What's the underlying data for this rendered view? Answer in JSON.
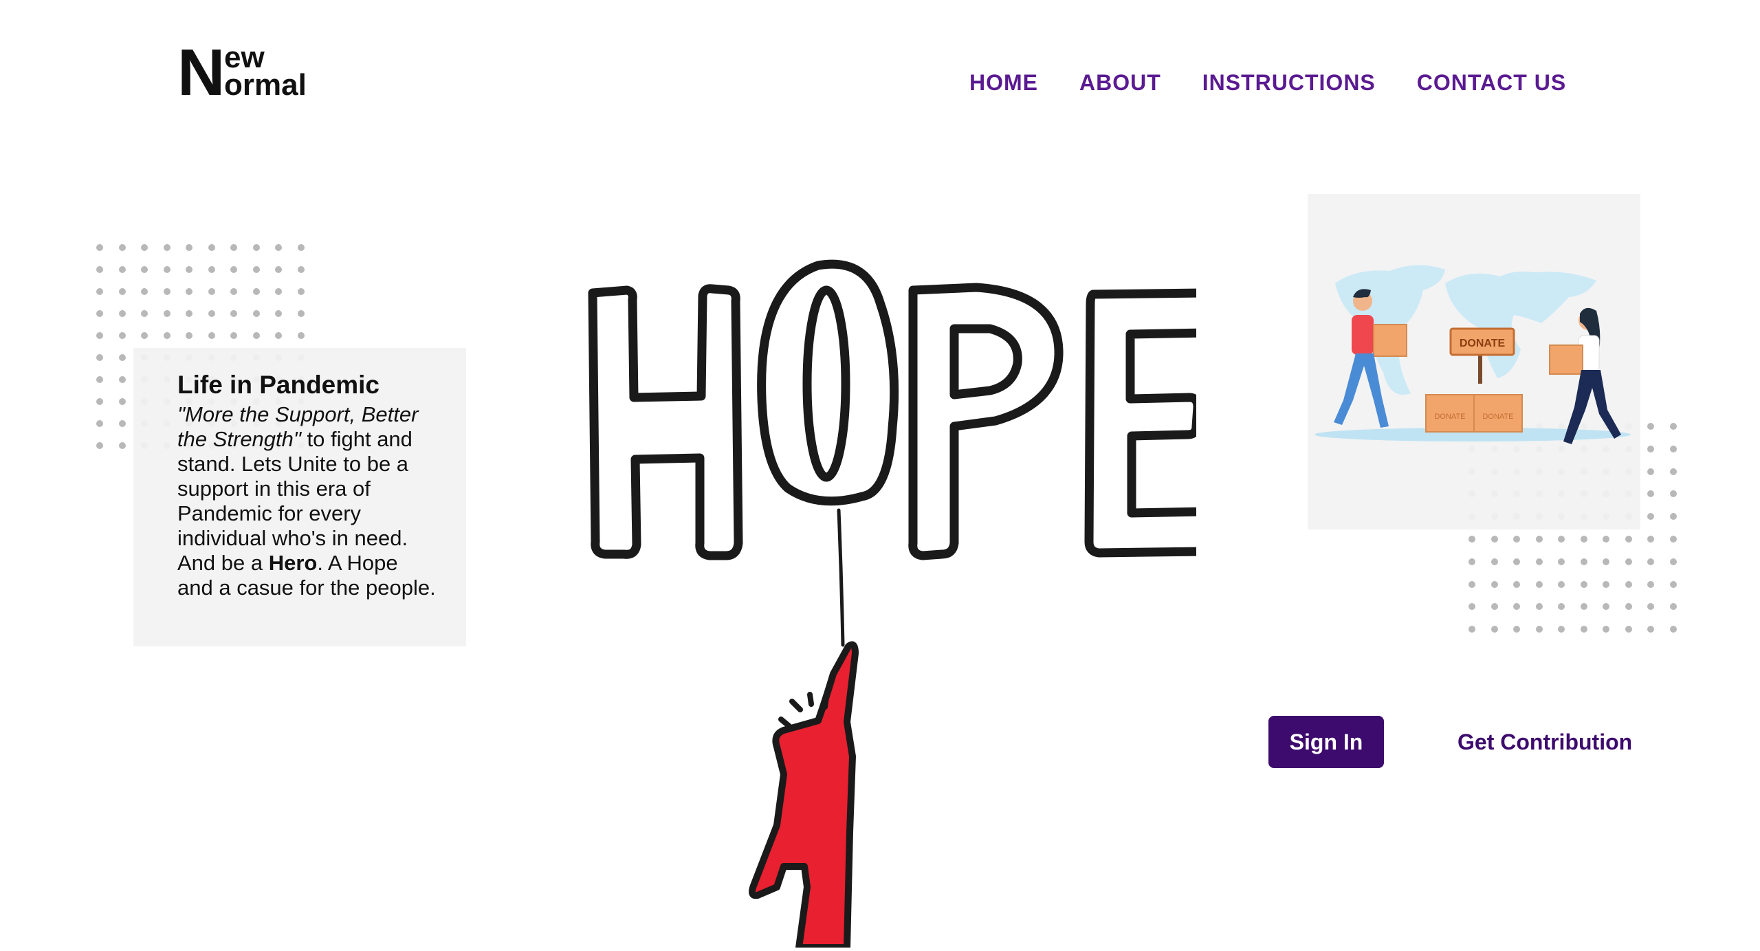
{
  "logo": {
    "big_letter": "N",
    "line1": "ew",
    "line2": "ormal"
  },
  "nav": {
    "items": [
      "HOME",
      "ABOUT",
      "INSTRUCTIONS",
      "CONTACT US"
    ]
  },
  "card": {
    "title": "Life in Pandemic",
    "quote": "\"More the Support, Better the Strength\"",
    "text_a": " to fight and stand. Lets Unite to be a support in this era of Pandemic for every individual who's in need. And be a ",
    "hero_word": "Hero",
    "text_b": ". A Hope and a casue for the people."
  },
  "hero": {
    "word": "HOPE"
  },
  "illustration": {
    "sign_label": "DONATE",
    "box_label_1": "DONATE",
    "box_label_2": "DONATE"
  },
  "actions": {
    "sign_in": "Sign In",
    "contribution": "Get Contribution"
  },
  "colors": {
    "accent": "#5a1a91",
    "button": "#3d0a6d",
    "figure": "#e8202f",
    "card_bg": "#f2f2f2"
  },
  "icons": {
    "hero_art": "hope-balloon-illustration",
    "donate_art": "donation-world-map-illustration"
  }
}
